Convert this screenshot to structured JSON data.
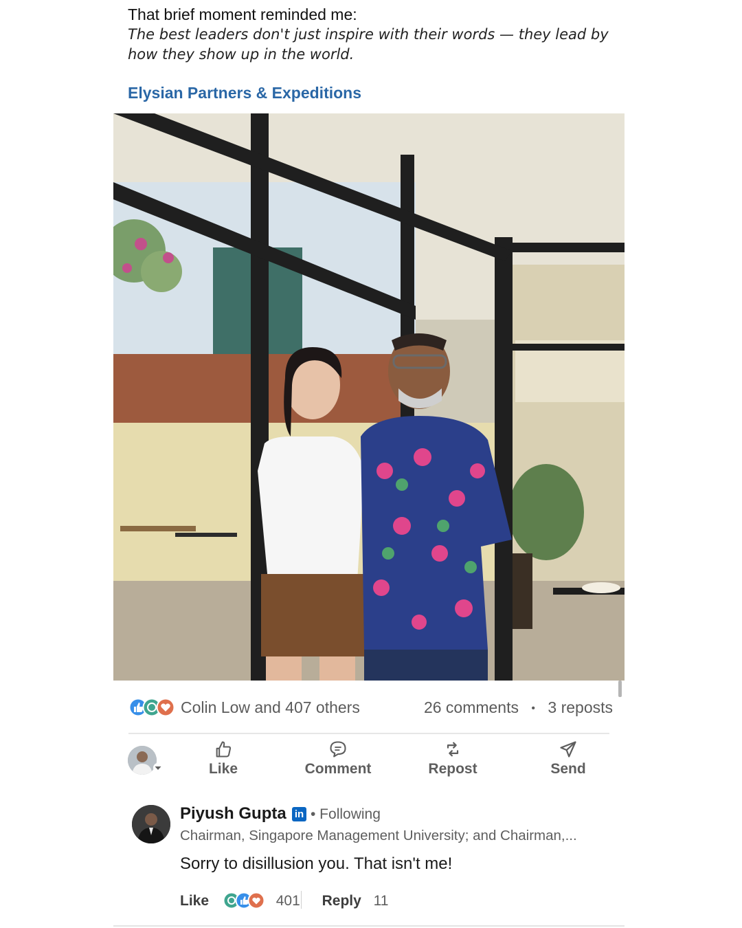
{
  "post": {
    "intro_line": "That brief moment reminded me:",
    "quote_line1": "The best leaders don't just inspire with their words — they lead by",
    "quote_line2": "how they show up in the world.",
    "company_link": "Elysian Partners & Expeditions",
    "image_description_icon": "photo"
  },
  "social": {
    "reaction_icons": [
      "like-icon",
      "celebrate-icon",
      "love-icon"
    ],
    "reactors": "Colin Low and 407 others",
    "comments": "26 comments",
    "dot": "•",
    "reposts": "3 reposts"
  },
  "actions": {
    "like": "Like",
    "comment": "Comment",
    "repost": "Repost",
    "send": "Send"
  },
  "comment": {
    "author": "Piyush Gupta",
    "badge": "in",
    "follow_status": "• Following",
    "headline": "Chairman, Singapore Management University; and Chairman,...",
    "text": "Sorry to disillusion you. That isn't me!",
    "like_label": "Like",
    "reaction_count": "401",
    "reply_label": "Reply",
    "reply_count": "11"
  },
  "colors": {
    "link_blue": "#2a67a6",
    "linkedin_blue": "#0a66c2",
    "muted_text": "#5e5e5e"
  }
}
